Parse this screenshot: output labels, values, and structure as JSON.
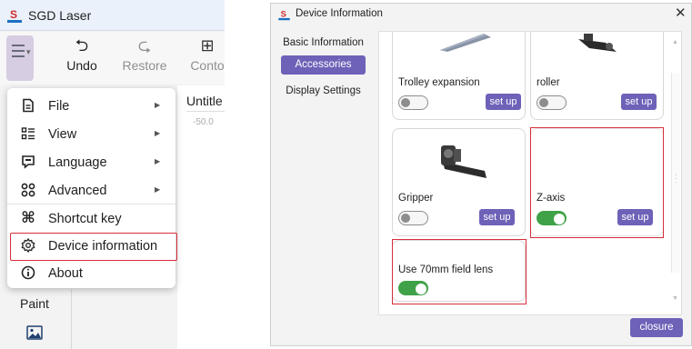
{
  "app": {
    "title": "SGD Laser",
    "logo_icon": "sgd-logo-icon"
  },
  "toolbar": {
    "menu_icon": "hamburger-menu-icon",
    "items": [
      {
        "label": "Undo",
        "icon": "undo-icon",
        "glyph": "⮌"
      },
      {
        "label": "Restore",
        "icon": "redo-icon",
        "glyph": "⮎"
      },
      {
        "label": "Conto",
        "icon": "contour-icon",
        "glyph": "⊞"
      }
    ]
  },
  "document": {
    "title": "Untitle",
    "ruler_value": "-50.0"
  },
  "menu": {
    "items": [
      {
        "label": "File",
        "icon": "file-icon",
        "has_submenu": true
      },
      {
        "label": "View",
        "icon": "view-icon",
        "has_submenu": true
      },
      {
        "label": "Language",
        "icon": "language-icon",
        "has_submenu": true
      },
      {
        "label": "Advanced",
        "icon": "advanced-icon",
        "has_submenu": true
      },
      {
        "label": "Shortcut key",
        "icon": "command-key-icon",
        "has_submenu": false
      },
      {
        "label": "Device information",
        "icon": "gear-icon",
        "has_submenu": false,
        "highlighted": true
      },
      {
        "label": "About",
        "icon": "info-icon",
        "has_submenu": false
      }
    ]
  },
  "sidebar": {
    "paint_label": "Paint",
    "paint_icon": "image-icon"
  },
  "dialog": {
    "title": "Device Information",
    "close_glyph": "✕",
    "nav": [
      {
        "label": "Basic Information",
        "active": false
      },
      {
        "label": "Accessories",
        "active": true
      },
      {
        "label": "Display Settings",
        "active": false
      }
    ],
    "accessories": [
      {
        "name": "Trolley expansion",
        "enabled": false,
        "setup_label": "set up"
      },
      {
        "name": "roller",
        "enabled": false,
        "setup_label": "set up"
      },
      {
        "name": "Gripper",
        "enabled": false,
        "setup_label": "set up"
      },
      {
        "name": "Z-axis",
        "enabled": true,
        "setup_label": "set up",
        "highlighted": true
      },
      {
        "name": "Use 70mm field lens",
        "enabled": true,
        "highlighted": true
      }
    ],
    "closure_label": "closure"
  },
  "colors": {
    "accent": "#6d62b8",
    "toggle_on": "#3fa248",
    "highlight": "#d62f3a",
    "menu_button_bg": "#d6cde2"
  }
}
